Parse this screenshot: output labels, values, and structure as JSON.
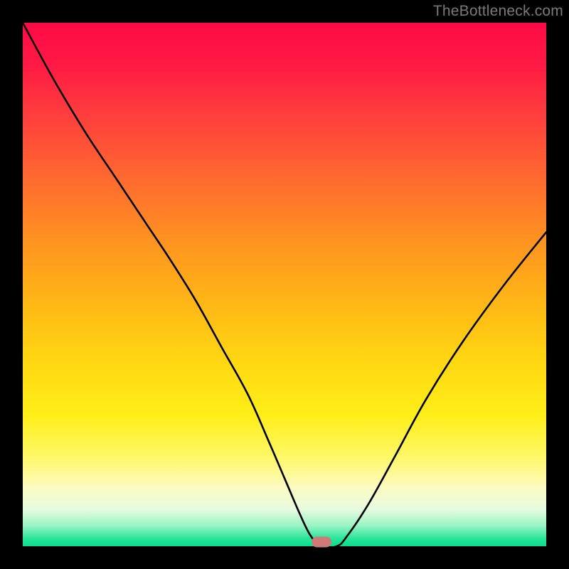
{
  "watermark": "TheBottleneck.com",
  "marker": {
    "x_pct": 57,
    "y_pct": 99.2,
    "color": "#cf7a78"
  },
  "chart_data": {
    "type": "line",
    "title": "",
    "xlabel": "",
    "ylabel": "",
    "xlim": [
      0,
      100
    ],
    "ylim": [
      0,
      100
    ],
    "grid": false,
    "legend": false,
    "series": [
      {
        "name": "bottleneck-curve",
        "x": [
          0,
          6,
          12,
          18,
          24,
          28,
          33,
          38,
          43,
          47,
          50,
          53,
          55,
          57,
          60,
          62,
          66,
          71,
          77,
          84,
          92,
          100
        ],
        "y": [
          100,
          89,
          79,
          70,
          61,
          55,
          47,
          38,
          29,
          20,
          13,
          6,
          2,
          0,
          0,
          2,
          8,
          17,
          28,
          39,
          50,
          60
        ]
      }
    ],
    "annotations": [
      {
        "type": "marker",
        "x": 57,
        "y": 0.8,
        "shape": "pill",
        "color": "#cf7a78"
      }
    ],
    "background_gradient": {
      "direction": "vertical",
      "stops": [
        {
          "pct": 0,
          "color": "#ff0a47"
        },
        {
          "pct": 30,
          "color": "#ff6a2f"
        },
        {
          "pct": 60,
          "color": "#ffd812"
        },
        {
          "pct": 85,
          "color": "#fcfbc4"
        },
        {
          "pct": 100,
          "color": "#05df8e"
        }
      ]
    }
  }
}
